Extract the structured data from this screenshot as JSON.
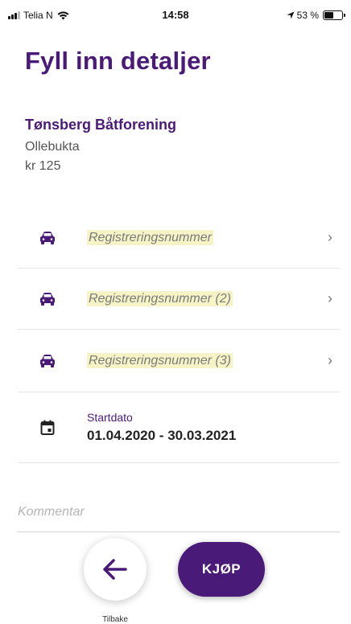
{
  "status_bar": {
    "carrier": "Telia N",
    "time": "14:58",
    "battery": "53 %",
    "battery_level": 0.53
  },
  "page": {
    "title": "Fyll inn detaljer"
  },
  "organization": {
    "name": "Tønsberg Båtforening",
    "location": "Ollebukta",
    "price": "kr 125"
  },
  "fields": {
    "registrations": [
      {
        "placeholder": "Registreringsnummer",
        "icon": "car-icon"
      },
      {
        "placeholder": "Registreringsnummer (2)",
        "icon": "car-icon"
      },
      {
        "placeholder": "Registreringsnummer (3)",
        "icon": "car-icon"
      }
    ],
    "start_date": {
      "label": "Startdato",
      "value": "01.04.2020 - 30.03.2021",
      "icon": "calendar-icon"
    },
    "comment": {
      "placeholder": "Kommentar"
    }
  },
  "actions": {
    "back_label": "Tilbake",
    "buy_label": "KJØP"
  },
  "colors": {
    "brand": "#4a1a78",
    "highlight": "#f6f4c6"
  }
}
